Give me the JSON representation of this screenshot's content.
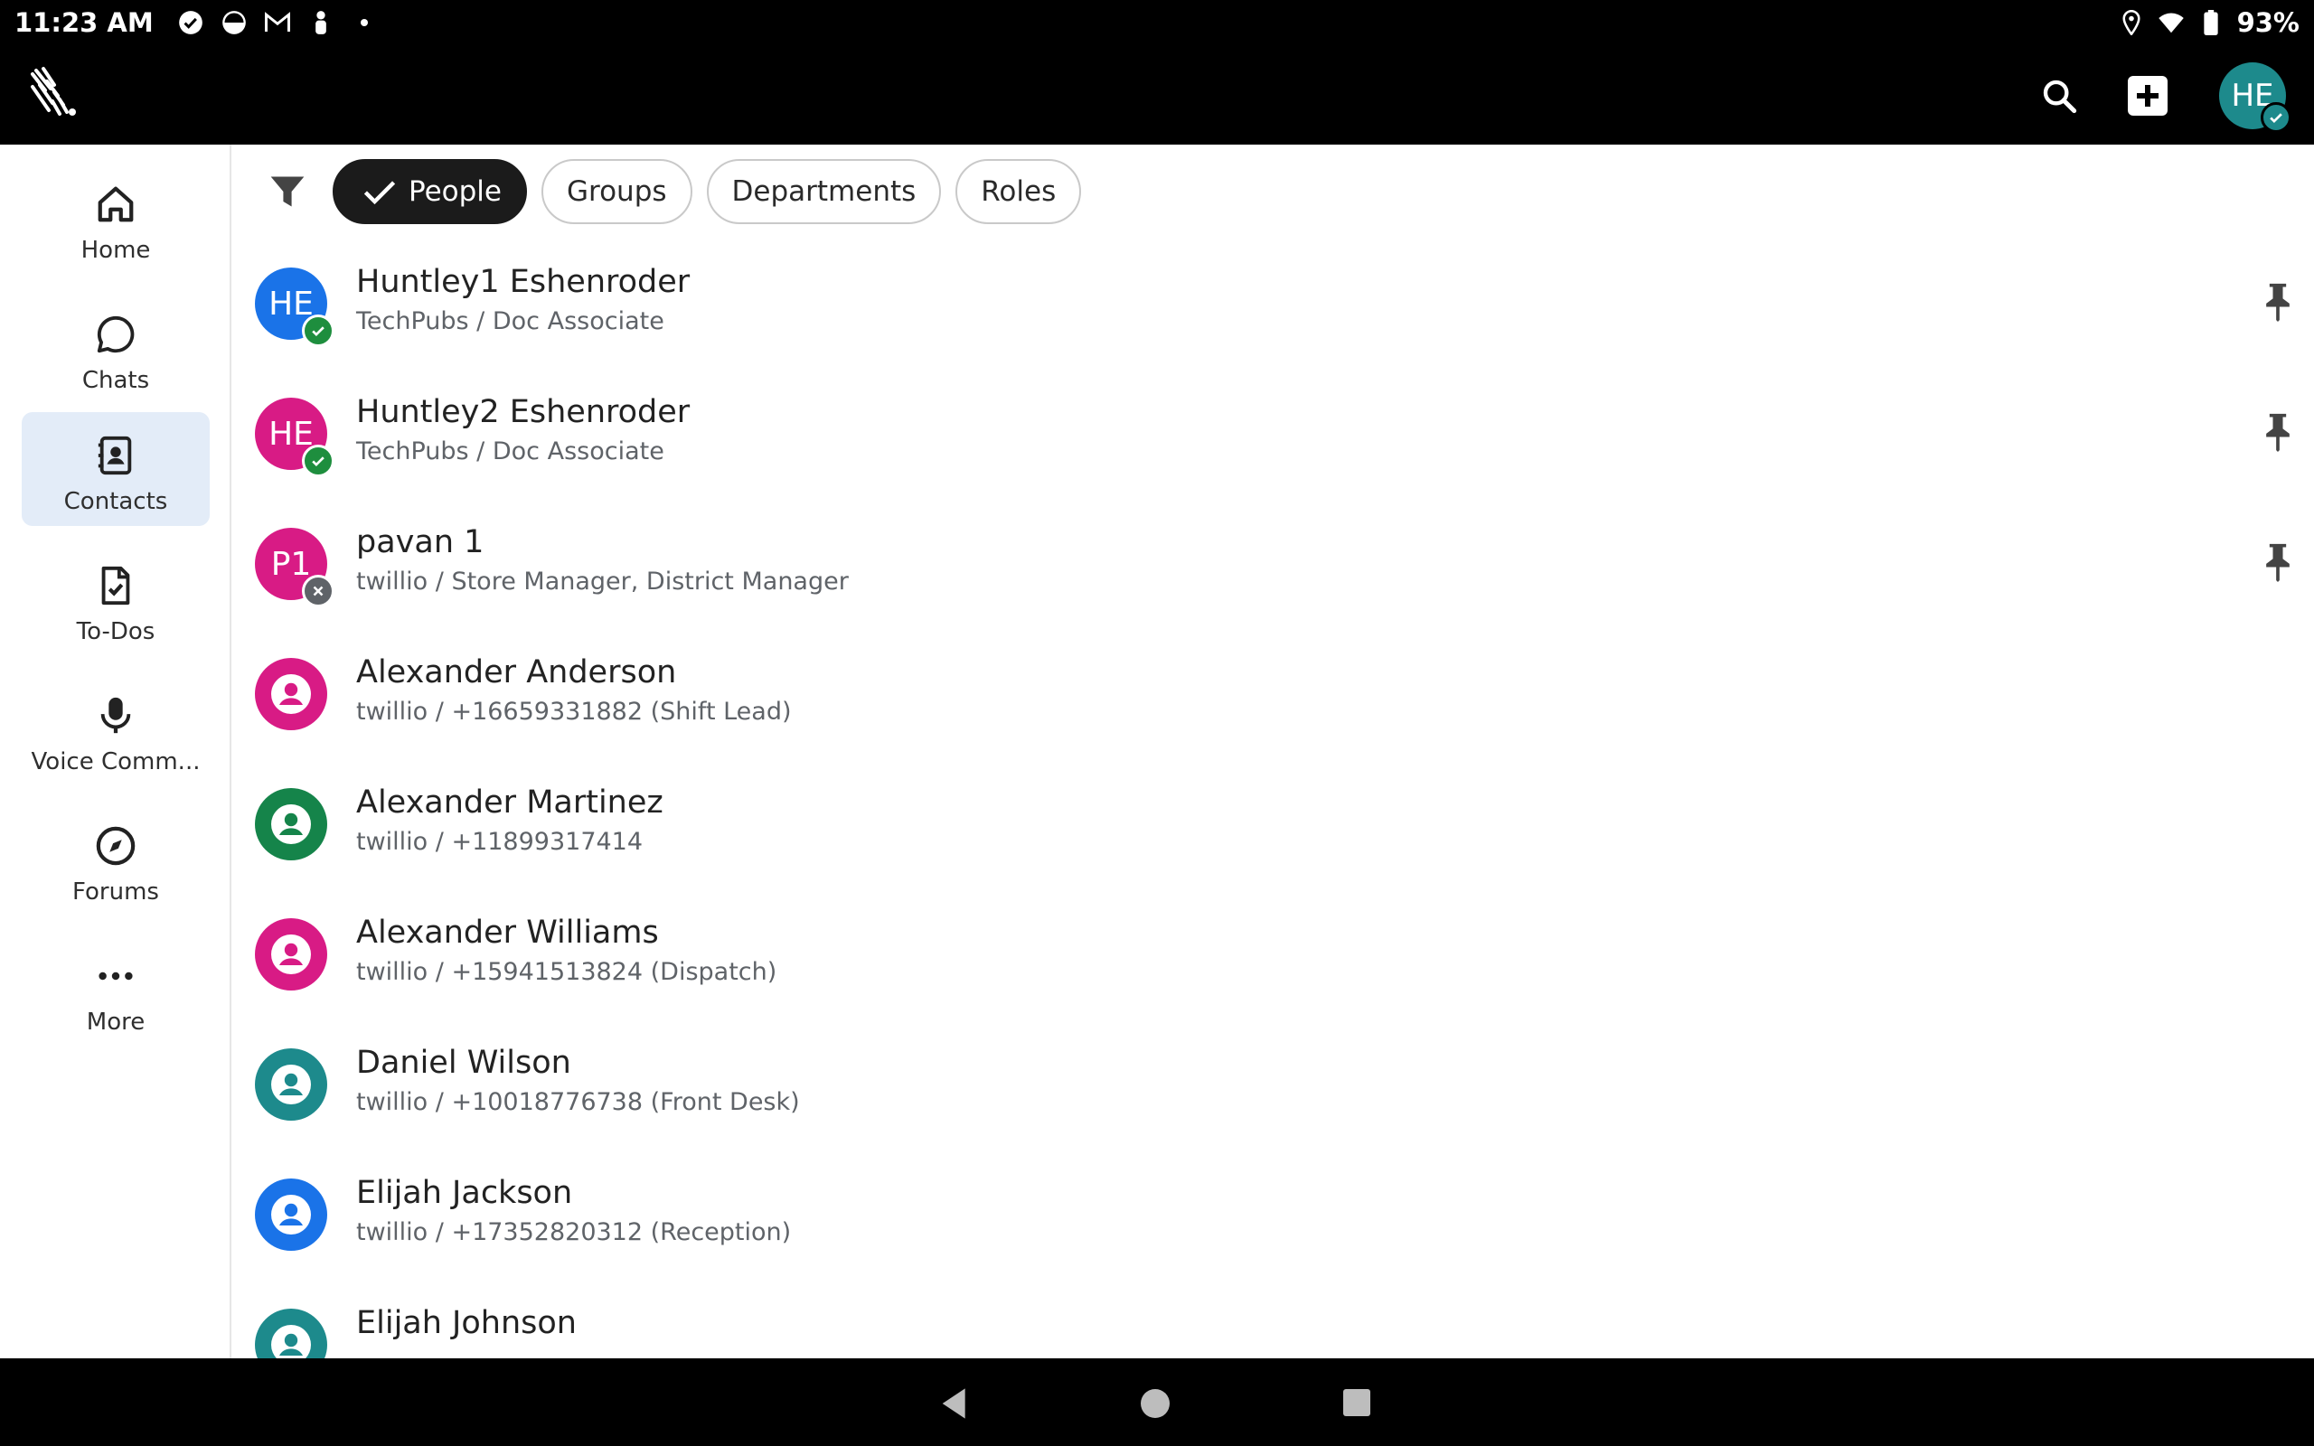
{
  "status_bar": {
    "time": "11:23 AM",
    "battery": "93%",
    "icons_left": [
      "check-circle-icon",
      "pinwheel-icon",
      "gmail-icon",
      "person-icon",
      "dot-icon"
    ],
    "icons_right": [
      "location-icon",
      "wifi-icon",
      "battery-icon"
    ]
  },
  "app_bar": {
    "avatar_initials": "HE",
    "icons": [
      "zebra-logo-icon",
      "search-icon",
      "add-icon"
    ]
  },
  "side_nav": {
    "items": [
      {
        "label": "Home",
        "icon": "home-icon"
      },
      {
        "label": "Chats",
        "icon": "chat-bubble-icon"
      },
      {
        "label": "Contacts",
        "icon": "contacts-book-icon",
        "active": true
      },
      {
        "label": "To-Dos",
        "icon": "todo-document-icon"
      },
      {
        "label": "Voice Comm...",
        "icon": "microphone-icon"
      },
      {
        "label": "Forums",
        "icon": "compass-icon"
      },
      {
        "label": "More",
        "icon": "more-dots-icon"
      }
    ]
  },
  "filters": {
    "chips": [
      {
        "label": "People",
        "selected": true
      },
      {
        "label": "Groups",
        "selected": false
      },
      {
        "label": "Departments",
        "selected": false
      },
      {
        "label": "Roles",
        "selected": false
      }
    ]
  },
  "contacts": [
    {
      "name": "Huntley1 Eshenroder",
      "subtitle": "TechPubs / Doc Associate",
      "initials": "HE",
      "color": "#1a73e8",
      "status": "online",
      "pinned": true
    },
    {
      "name": "Huntley2 Eshenroder",
      "subtitle": "TechPubs / Doc Associate",
      "initials": "HE",
      "color": "#d81b85",
      "status": "online",
      "pinned": true
    },
    {
      "name": "pavan 1",
      "subtitle": "twillio / Store Manager, District Manager",
      "initials": "P1",
      "color": "#d81b85",
      "status": "offline",
      "pinned": true
    },
    {
      "name": "Alexander Anderson",
      "subtitle": "twillio / +16659331882 (Shift Lead)",
      "initials": "",
      "color": "#d81b85",
      "status": "",
      "pinned": false
    },
    {
      "name": "Alexander Martinez",
      "subtitle": "twillio / +11899317414",
      "initials": "",
      "color": "#15844a",
      "status": "",
      "pinned": false
    },
    {
      "name": "Alexander Williams",
      "subtitle": "twillio / +15941513824 (Dispatch)",
      "initials": "",
      "color": "#d81b85",
      "status": "",
      "pinned": false
    },
    {
      "name": "Daniel Wilson",
      "subtitle": "twillio / +10018776738 (Front Desk)",
      "initials": "",
      "color": "#1d8a8c",
      "status": "",
      "pinned": false
    },
    {
      "name": "Elijah Jackson",
      "subtitle": "twillio / +17352820312 (Reception)",
      "initials": "",
      "color": "#1a73e8",
      "status": "",
      "pinned": false
    },
    {
      "name": "Elijah Johnson",
      "subtitle": "",
      "initials": "",
      "color": "#1d8a8c",
      "status": "",
      "pinned": false
    }
  ],
  "colors": {
    "online": "#1e8e3e",
    "offline": "#5f6368",
    "active_nav_bg": "#e3ecf8",
    "chip_selected_bg": "#1b1b1b"
  }
}
